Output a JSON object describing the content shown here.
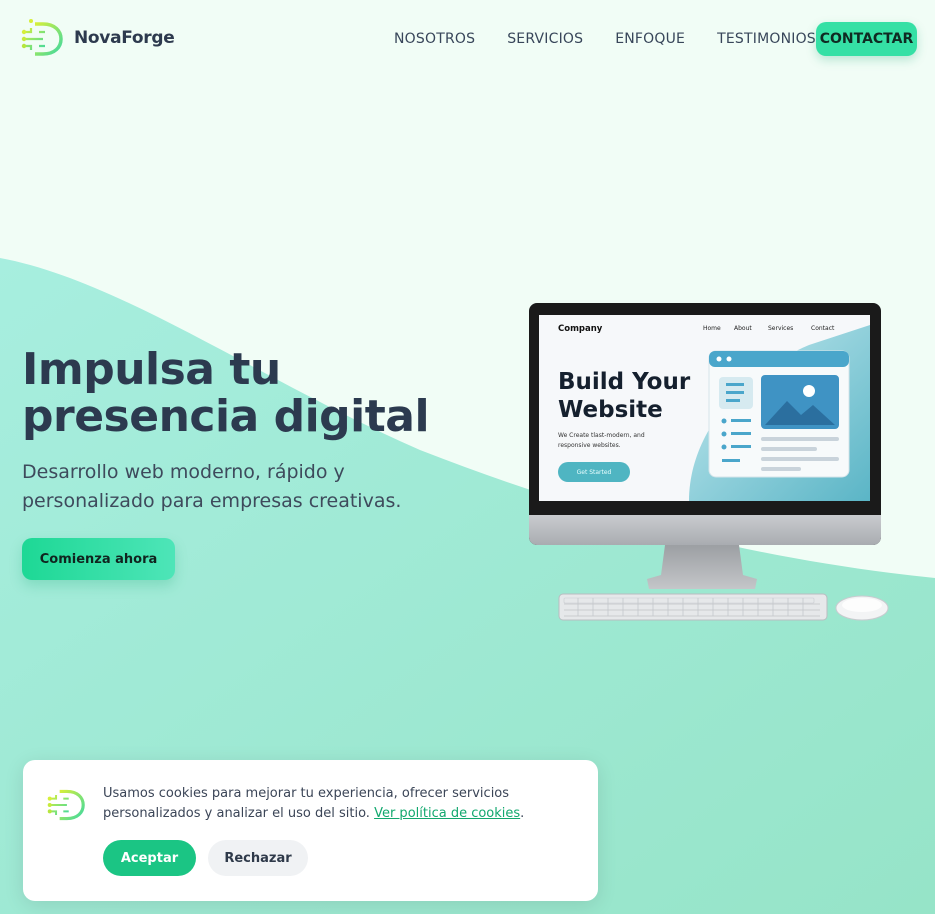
{
  "brand": {
    "name": "NovaForge",
    "logo_icon": "circuit-d-logo-icon"
  },
  "nav": {
    "items": [
      {
        "label": "NOSOTROS"
      },
      {
        "label": "SERVICIOS"
      },
      {
        "label": "ENFOQUE"
      },
      {
        "label": "TESTIMONIOS"
      }
    ],
    "cta_label": "CONTACTAR"
  },
  "hero": {
    "title": "Impulsa tu presencia digital",
    "subtitle": "Desarrollo web moderno, rápido y personalizado para empresas creativas.",
    "button_label": "Comienza ahora"
  },
  "mockup": {
    "company": "Company",
    "nav": [
      "Home",
      "About",
      "Services",
      "Contact"
    ],
    "title": "Build Your Website",
    "subtitle": "We Create tlast-modern, and responsive websites.",
    "button": "Get Started"
  },
  "cookie": {
    "text": "Usamos cookies para mejorar tu experiencia, ofrecer servicios personalizados y analizar el uso del sitio.",
    "link": "Ver política de cookies",
    "accept": "Aceptar",
    "reject": "Rechazar"
  },
  "colors": {
    "accent": "#35e0a5",
    "accent_dark": "#1bc584",
    "background_light": "#f1fdf6",
    "wave": "#a6ecda",
    "text_dark": "#2c3a4f",
    "link": "#12a86e"
  }
}
